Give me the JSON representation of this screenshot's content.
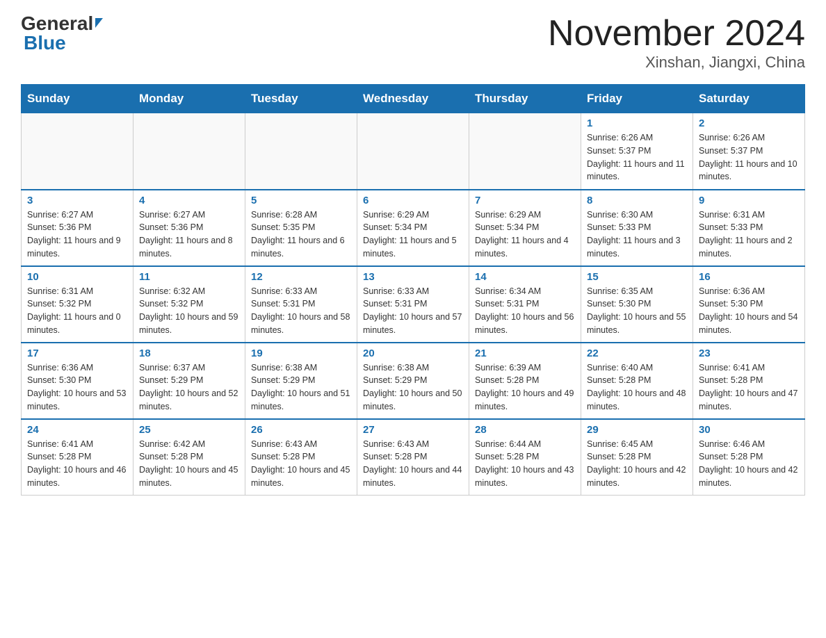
{
  "header": {
    "logo_general": "General",
    "logo_blue": "Blue",
    "main_title": "November 2024",
    "sub_title": "Xinshan, Jiangxi, China"
  },
  "days_of_week": [
    "Sunday",
    "Monday",
    "Tuesday",
    "Wednesday",
    "Thursday",
    "Friday",
    "Saturday"
  ],
  "weeks": [
    [
      {
        "day": "",
        "sunrise": "",
        "sunset": "",
        "daylight": ""
      },
      {
        "day": "",
        "sunrise": "",
        "sunset": "",
        "daylight": ""
      },
      {
        "day": "",
        "sunrise": "",
        "sunset": "",
        "daylight": ""
      },
      {
        "day": "",
        "sunrise": "",
        "sunset": "",
        "daylight": ""
      },
      {
        "day": "",
        "sunrise": "",
        "sunset": "",
        "daylight": ""
      },
      {
        "day": "1",
        "sunrise": "Sunrise: 6:26 AM",
        "sunset": "Sunset: 5:37 PM",
        "daylight": "Daylight: 11 hours and 11 minutes."
      },
      {
        "day": "2",
        "sunrise": "Sunrise: 6:26 AM",
        "sunset": "Sunset: 5:37 PM",
        "daylight": "Daylight: 11 hours and 10 minutes."
      }
    ],
    [
      {
        "day": "3",
        "sunrise": "Sunrise: 6:27 AM",
        "sunset": "Sunset: 5:36 PM",
        "daylight": "Daylight: 11 hours and 9 minutes."
      },
      {
        "day": "4",
        "sunrise": "Sunrise: 6:27 AM",
        "sunset": "Sunset: 5:36 PM",
        "daylight": "Daylight: 11 hours and 8 minutes."
      },
      {
        "day": "5",
        "sunrise": "Sunrise: 6:28 AM",
        "sunset": "Sunset: 5:35 PM",
        "daylight": "Daylight: 11 hours and 6 minutes."
      },
      {
        "day": "6",
        "sunrise": "Sunrise: 6:29 AM",
        "sunset": "Sunset: 5:34 PM",
        "daylight": "Daylight: 11 hours and 5 minutes."
      },
      {
        "day": "7",
        "sunrise": "Sunrise: 6:29 AM",
        "sunset": "Sunset: 5:34 PM",
        "daylight": "Daylight: 11 hours and 4 minutes."
      },
      {
        "day": "8",
        "sunrise": "Sunrise: 6:30 AM",
        "sunset": "Sunset: 5:33 PM",
        "daylight": "Daylight: 11 hours and 3 minutes."
      },
      {
        "day": "9",
        "sunrise": "Sunrise: 6:31 AM",
        "sunset": "Sunset: 5:33 PM",
        "daylight": "Daylight: 11 hours and 2 minutes."
      }
    ],
    [
      {
        "day": "10",
        "sunrise": "Sunrise: 6:31 AM",
        "sunset": "Sunset: 5:32 PM",
        "daylight": "Daylight: 11 hours and 0 minutes."
      },
      {
        "day": "11",
        "sunrise": "Sunrise: 6:32 AM",
        "sunset": "Sunset: 5:32 PM",
        "daylight": "Daylight: 10 hours and 59 minutes."
      },
      {
        "day": "12",
        "sunrise": "Sunrise: 6:33 AM",
        "sunset": "Sunset: 5:31 PM",
        "daylight": "Daylight: 10 hours and 58 minutes."
      },
      {
        "day": "13",
        "sunrise": "Sunrise: 6:33 AM",
        "sunset": "Sunset: 5:31 PM",
        "daylight": "Daylight: 10 hours and 57 minutes."
      },
      {
        "day": "14",
        "sunrise": "Sunrise: 6:34 AM",
        "sunset": "Sunset: 5:31 PM",
        "daylight": "Daylight: 10 hours and 56 minutes."
      },
      {
        "day": "15",
        "sunrise": "Sunrise: 6:35 AM",
        "sunset": "Sunset: 5:30 PM",
        "daylight": "Daylight: 10 hours and 55 minutes."
      },
      {
        "day": "16",
        "sunrise": "Sunrise: 6:36 AM",
        "sunset": "Sunset: 5:30 PM",
        "daylight": "Daylight: 10 hours and 54 minutes."
      }
    ],
    [
      {
        "day": "17",
        "sunrise": "Sunrise: 6:36 AM",
        "sunset": "Sunset: 5:30 PM",
        "daylight": "Daylight: 10 hours and 53 minutes."
      },
      {
        "day": "18",
        "sunrise": "Sunrise: 6:37 AM",
        "sunset": "Sunset: 5:29 PM",
        "daylight": "Daylight: 10 hours and 52 minutes."
      },
      {
        "day": "19",
        "sunrise": "Sunrise: 6:38 AM",
        "sunset": "Sunset: 5:29 PM",
        "daylight": "Daylight: 10 hours and 51 minutes."
      },
      {
        "day": "20",
        "sunrise": "Sunrise: 6:38 AM",
        "sunset": "Sunset: 5:29 PM",
        "daylight": "Daylight: 10 hours and 50 minutes."
      },
      {
        "day": "21",
        "sunrise": "Sunrise: 6:39 AM",
        "sunset": "Sunset: 5:28 PM",
        "daylight": "Daylight: 10 hours and 49 minutes."
      },
      {
        "day": "22",
        "sunrise": "Sunrise: 6:40 AM",
        "sunset": "Sunset: 5:28 PM",
        "daylight": "Daylight: 10 hours and 48 minutes."
      },
      {
        "day": "23",
        "sunrise": "Sunrise: 6:41 AM",
        "sunset": "Sunset: 5:28 PM",
        "daylight": "Daylight: 10 hours and 47 minutes."
      }
    ],
    [
      {
        "day": "24",
        "sunrise": "Sunrise: 6:41 AM",
        "sunset": "Sunset: 5:28 PM",
        "daylight": "Daylight: 10 hours and 46 minutes."
      },
      {
        "day": "25",
        "sunrise": "Sunrise: 6:42 AM",
        "sunset": "Sunset: 5:28 PM",
        "daylight": "Daylight: 10 hours and 45 minutes."
      },
      {
        "day": "26",
        "sunrise": "Sunrise: 6:43 AM",
        "sunset": "Sunset: 5:28 PM",
        "daylight": "Daylight: 10 hours and 45 minutes."
      },
      {
        "day": "27",
        "sunrise": "Sunrise: 6:43 AM",
        "sunset": "Sunset: 5:28 PM",
        "daylight": "Daylight: 10 hours and 44 minutes."
      },
      {
        "day": "28",
        "sunrise": "Sunrise: 6:44 AM",
        "sunset": "Sunset: 5:28 PM",
        "daylight": "Daylight: 10 hours and 43 minutes."
      },
      {
        "day": "29",
        "sunrise": "Sunrise: 6:45 AM",
        "sunset": "Sunset: 5:28 PM",
        "daylight": "Daylight: 10 hours and 42 minutes."
      },
      {
        "day": "30",
        "sunrise": "Sunrise: 6:46 AM",
        "sunset": "Sunset: 5:28 PM",
        "daylight": "Daylight: 10 hours and 42 minutes."
      }
    ]
  ]
}
